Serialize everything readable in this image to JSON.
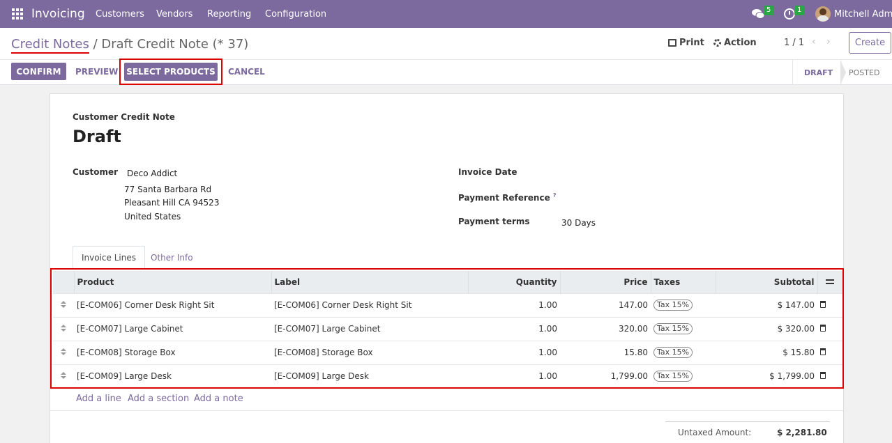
{
  "navbar": {
    "app_name": "Invoicing",
    "menu": [
      "Customers",
      "Vendors",
      "Reporting",
      "Configuration"
    ],
    "messages_count": "5",
    "activities_count": "1",
    "user_name": "Mitchell Admin"
  },
  "control_panel": {
    "breadcrumb_parent": "Credit Notes",
    "breadcrumb_separator": " / ",
    "breadcrumb_current": "Draft Credit Note (* 37)",
    "print_label": "Print",
    "action_label": "Action",
    "pager": "1 / 1",
    "pager_prev": "‹",
    "pager_next": "›",
    "create_label": "Create",
    "buttons": {
      "confirm": "CONFIRM",
      "preview": "PREVIEW",
      "select_products": "SELECT PRODUCTS",
      "cancel": "CANCEL"
    },
    "statuses": [
      "DRAFT",
      "POSTED"
    ]
  },
  "form": {
    "doc_type": "Customer Credit Note",
    "title": "Draft",
    "customer_label": "Customer",
    "customer_name": "Deco Addict",
    "address": [
      "77 Santa Barbara Rd",
      "Pleasant Hill CA 94523",
      "United States"
    ],
    "invoice_date_label": "Invoice Date",
    "payment_reference_label": "Payment Reference",
    "payment_reference_help": "?",
    "payment_terms_label": "Payment terms",
    "payment_terms_value": "30 Days",
    "tabs": [
      "Invoice Lines",
      "Other Info"
    ]
  },
  "lines": {
    "headers": [
      "Product",
      "Label",
      "Quantity",
      "Price",
      "Taxes",
      "Subtotal"
    ],
    "rows": [
      {
        "product": "[E-COM06] Corner Desk Right Sit",
        "label": "[E-COM06] Corner Desk Right Sit",
        "quantity": "1.00",
        "price": "147.00",
        "tax": "Tax 15%",
        "subtotal": "$ 147.00"
      },
      {
        "product": "[E-COM07] Large Cabinet",
        "label": "[E-COM07] Large Cabinet",
        "quantity": "1.00",
        "price": "320.00",
        "tax": "Tax 15%",
        "subtotal": "$ 320.00"
      },
      {
        "product": "[E-COM08] Storage Box",
        "label": "[E-COM08] Storage Box",
        "quantity": "1.00",
        "price": "15.80",
        "tax": "Tax 15%",
        "subtotal": "$ 15.80"
      },
      {
        "product": "[E-COM09] Large Desk",
        "label": "[E-COM09] Large Desk",
        "quantity": "1.00",
        "price": "1,799.00",
        "tax": "Tax 15%",
        "subtotal": "$ 1,799.00"
      }
    ],
    "add_line": "Add a line",
    "add_section": "Add a section",
    "add_note": "Add a note"
  },
  "totals": {
    "untaxed_label": "Untaxed Amount:",
    "untaxed_value": "$ 2,281.80"
  },
  "colors": {
    "brand": "#7c6a9e",
    "highlight": "#dd0000",
    "badge": "#28a745"
  }
}
